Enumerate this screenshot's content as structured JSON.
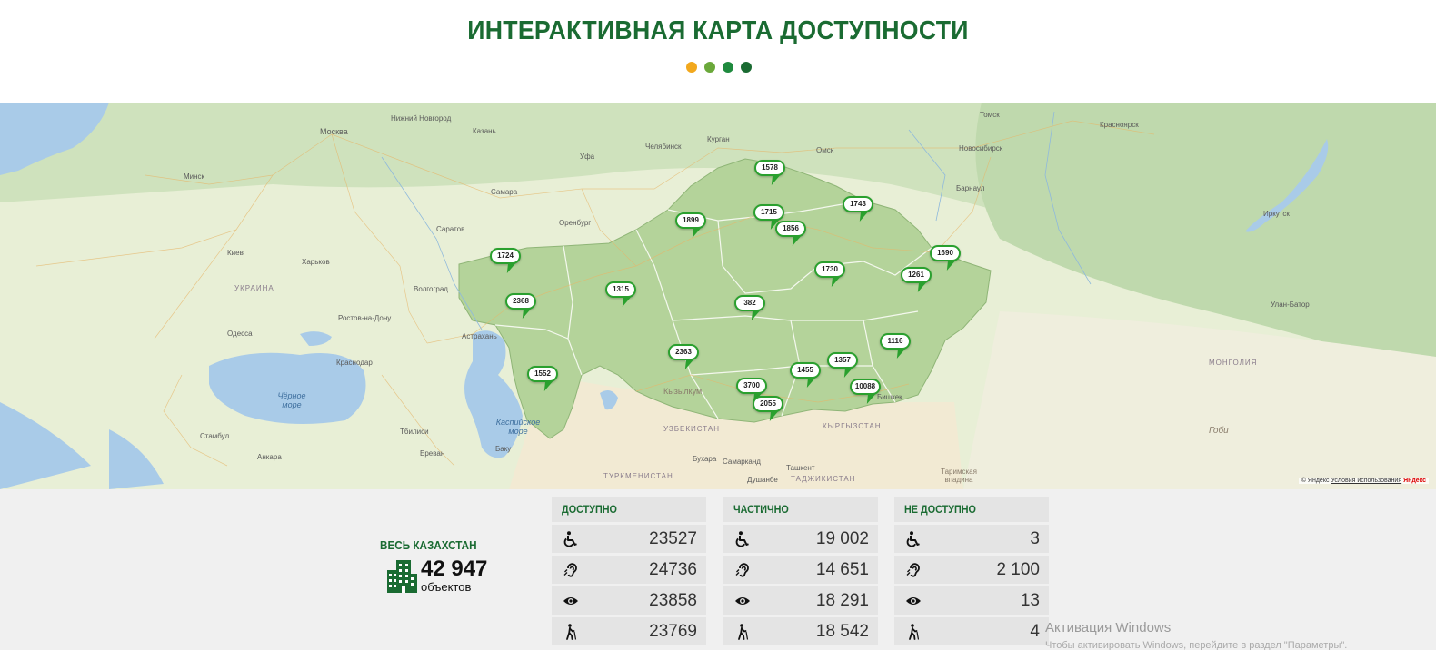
{
  "header": {
    "title": "ИНТЕРАКТИВНАЯ КАРТА ДОСТУПНОСТИ",
    "dot_colors": [
      "#f2a81d",
      "#6aa83a",
      "#1f8a3e",
      "#1a6b32"
    ]
  },
  "map": {
    "labels": {
      "moscow": "Москва",
      "nizhny": "Нижний Новгород",
      "kazan": "Казань",
      "samara": "Самара",
      "saratov": "Саратов",
      "volgograd": "Волгоград",
      "orenburg": "Оренбург",
      "ufa": "Уфа",
      "chelyabinsk": "Челябинск",
      "kurgan": "Курган",
      "omsk": "Омск",
      "novosibirsk": "Новосибирск",
      "tomsk": "Томск",
      "krasnoyarsk": "Красноярск",
      "irkutsk": "Иркутск",
      "barnaul": "Барнаул",
      "kiev": "Киев",
      "minsk": "Минск",
      "kharkov": "Харьков",
      "odessa": "Одесса",
      "rostov": "Ростов-на-Дону",
      "astrakhan": "Астрахань",
      "krasnodar": "Краснодар",
      "tbilisi": "Тбилиси",
      "erevan": "Ереван",
      "baku": "Баку",
      "istanbul": "Стамбул",
      "ankara": "Анкара",
      "tashkent": "Ташкент",
      "bukhara": "Бухара",
      "samarkand": "Самарканд",
      "dushanbe": "Душанбе",
      "bishkek": "Бишкек",
      "ulanbator": "Улан-Батор",
      "black_sea": "Чёрное море",
      "caspian": "Каспийское море",
      "ukraine": "УКРАИНА",
      "mongolia": "МОНГОЛИЯ",
      "uzbekistan": "УЗБЕКИСТАН",
      "turkmenistan": "ТУРКМЕНИСТАН",
      "kyrgyzstan": "КЫРГЫЗСТАН",
      "tajikistan": "ТАДЖИКИСТАН",
      "tarim": "Таримская впадина",
      "gobi": "Гоби",
      "kyzylkum": "Кызылкум"
    },
    "markers": [
      {
        "value": "1578"
      },
      {
        "value": "1743"
      },
      {
        "value": "1715"
      },
      {
        "value": "1899"
      },
      {
        "value": "1856"
      },
      {
        "value": "1724"
      },
      {
        "value": "1690"
      },
      {
        "value": "1730"
      },
      {
        "value": "1261"
      },
      {
        "value": "1315"
      },
      {
        "value": "2368"
      },
      {
        "value": "382"
      },
      {
        "value": "1116"
      },
      {
        "value": "2363"
      },
      {
        "value": "1552"
      },
      {
        "value": "1357"
      },
      {
        "value": "1455"
      },
      {
        "value": "3700"
      },
      {
        "value": "10088"
      },
      {
        "value": "2055"
      }
    ],
    "copyright_prefix": "© Яндекс",
    "copyright_link": "Условия использования",
    "brand": "Яндекс"
  },
  "summary": {
    "label": "ВЕСЬ КАЗАХСТАН",
    "count": "42 947",
    "unit": "объектов"
  },
  "columns": [
    {
      "header": "ДОСТУПНО",
      "rows": [
        {
          "icon": "wheelchair-icon",
          "value": "23527"
        },
        {
          "icon": "hearing-icon",
          "value": "24736"
        },
        {
          "icon": "eye-icon",
          "value": "23858"
        },
        {
          "icon": "walking-cane-icon",
          "value": "23769"
        }
      ]
    },
    {
      "header": "ЧАСТИЧНО",
      "rows": [
        {
          "icon": "wheelchair-icon",
          "value": "19 002"
        },
        {
          "icon": "hearing-icon",
          "value": "14 651"
        },
        {
          "icon": "eye-icon",
          "value": "18 291"
        },
        {
          "icon": "walking-cane-icon",
          "value": "18 542"
        }
      ]
    },
    {
      "header": "НЕ ДОСТУПНО",
      "rows": [
        {
          "icon": "wheelchair-icon",
          "value": "3"
        },
        {
          "icon": "hearing-icon",
          "value": "2 100"
        },
        {
          "icon": "eye-icon",
          "value": "13"
        },
        {
          "icon": "walking-cane-icon",
          "value": "4"
        }
      ]
    }
  ],
  "watermark": {
    "title": "Активация Windows",
    "subtitle": "Чтобы активировать Windows, перейдите в раздел \"Параметры\"."
  }
}
